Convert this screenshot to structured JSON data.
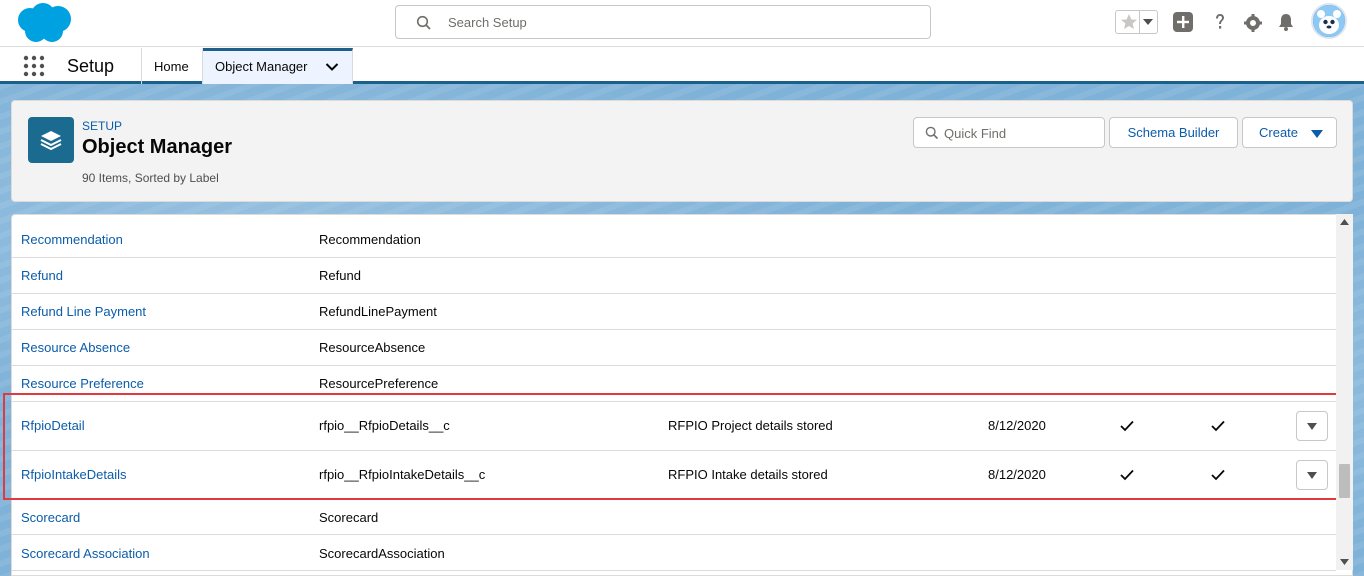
{
  "global_header": {
    "search_placeholder": "Search Setup",
    "icons": [
      "salesforce-cloud-logo",
      "favorites-star-icon",
      "add-icon",
      "help-icon",
      "settings-gear-icon",
      "notifications-bell-icon",
      "user-avatar"
    ]
  },
  "context_bar": {
    "app_name": "Setup",
    "tabs": [
      {
        "label": "Home"
      },
      {
        "label": "Object Manager"
      }
    ]
  },
  "page_header": {
    "eyebrow": "SETUP",
    "title": "Object Manager",
    "meta": "90 Items, Sorted by Label",
    "quick_find_placeholder": "Quick Find",
    "schema_builder_label": "Schema Builder",
    "create_label": "Create"
  },
  "rows": [
    {
      "label": "Recommendation",
      "api_name": "Recommendation",
      "description": "",
      "last_modified": "",
      "deployed": false,
      "custom": false,
      "has_actions": false
    },
    {
      "label": "Refund",
      "api_name": "Refund",
      "description": "",
      "last_modified": "",
      "deployed": false,
      "custom": false,
      "has_actions": false
    },
    {
      "label": "Refund Line Payment",
      "api_name": "RefundLinePayment",
      "description": "",
      "last_modified": "",
      "deployed": false,
      "custom": false,
      "has_actions": false
    },
    {
      "label": "Resource Absence",
      "api_name": "ResourceAbsence",
      "description": "",
      "last_modified": "",
      "deployed": false,
      "custom": false,
      "has_actions": false
    },
    {
      "label": "Resource Preference",
      "api_name": "ResourcePreference",
      "description": "",
      "last_modified": "",
      "deployed": false,
      "custom": false,
      "has_actions": false
    },
    {
      "label": "RfpioDetail",
      "api_name": "rfpio__RfpioDetails__c",
      "description": "RFPIO Project details stored",
      "last_modified": "8/12/2020",
      "deployed": true,
      "custom": true,
      "has_actions": true
    },
    {
      "label": "RfpioIntakeDetails",
      "api_name": "rfpio__RfpioIntakeDetails__c",
      "description": "RFPIO Intake details stored",
      "last_modified": "8/12/2020",
      "deployed": true,
      "custom": true,
      "has_actions": true
    },
    {
      "label": "Scorecard",
      "api_name": "Scorecard",
      "description": "",
      "last_modified": "",
      "deployed": false,
      "custom": false,
      "has_actions": false
    },
    {
      "label": "Scorecard Association",
      "api_name": "ScorecardAssociation",
      "description": "",
      "last_modified": "",
      "deployed": false,
      "custom": false,
      "has_actions": false
    }
  ],
  "colors": {
    "brand_blue": "#00a1e0",
    "link_blue": "#0b5cab",
    "highlight_red": "#e03a3e",
    "object_icon_teal": "#1b6a8f"
  }
}
